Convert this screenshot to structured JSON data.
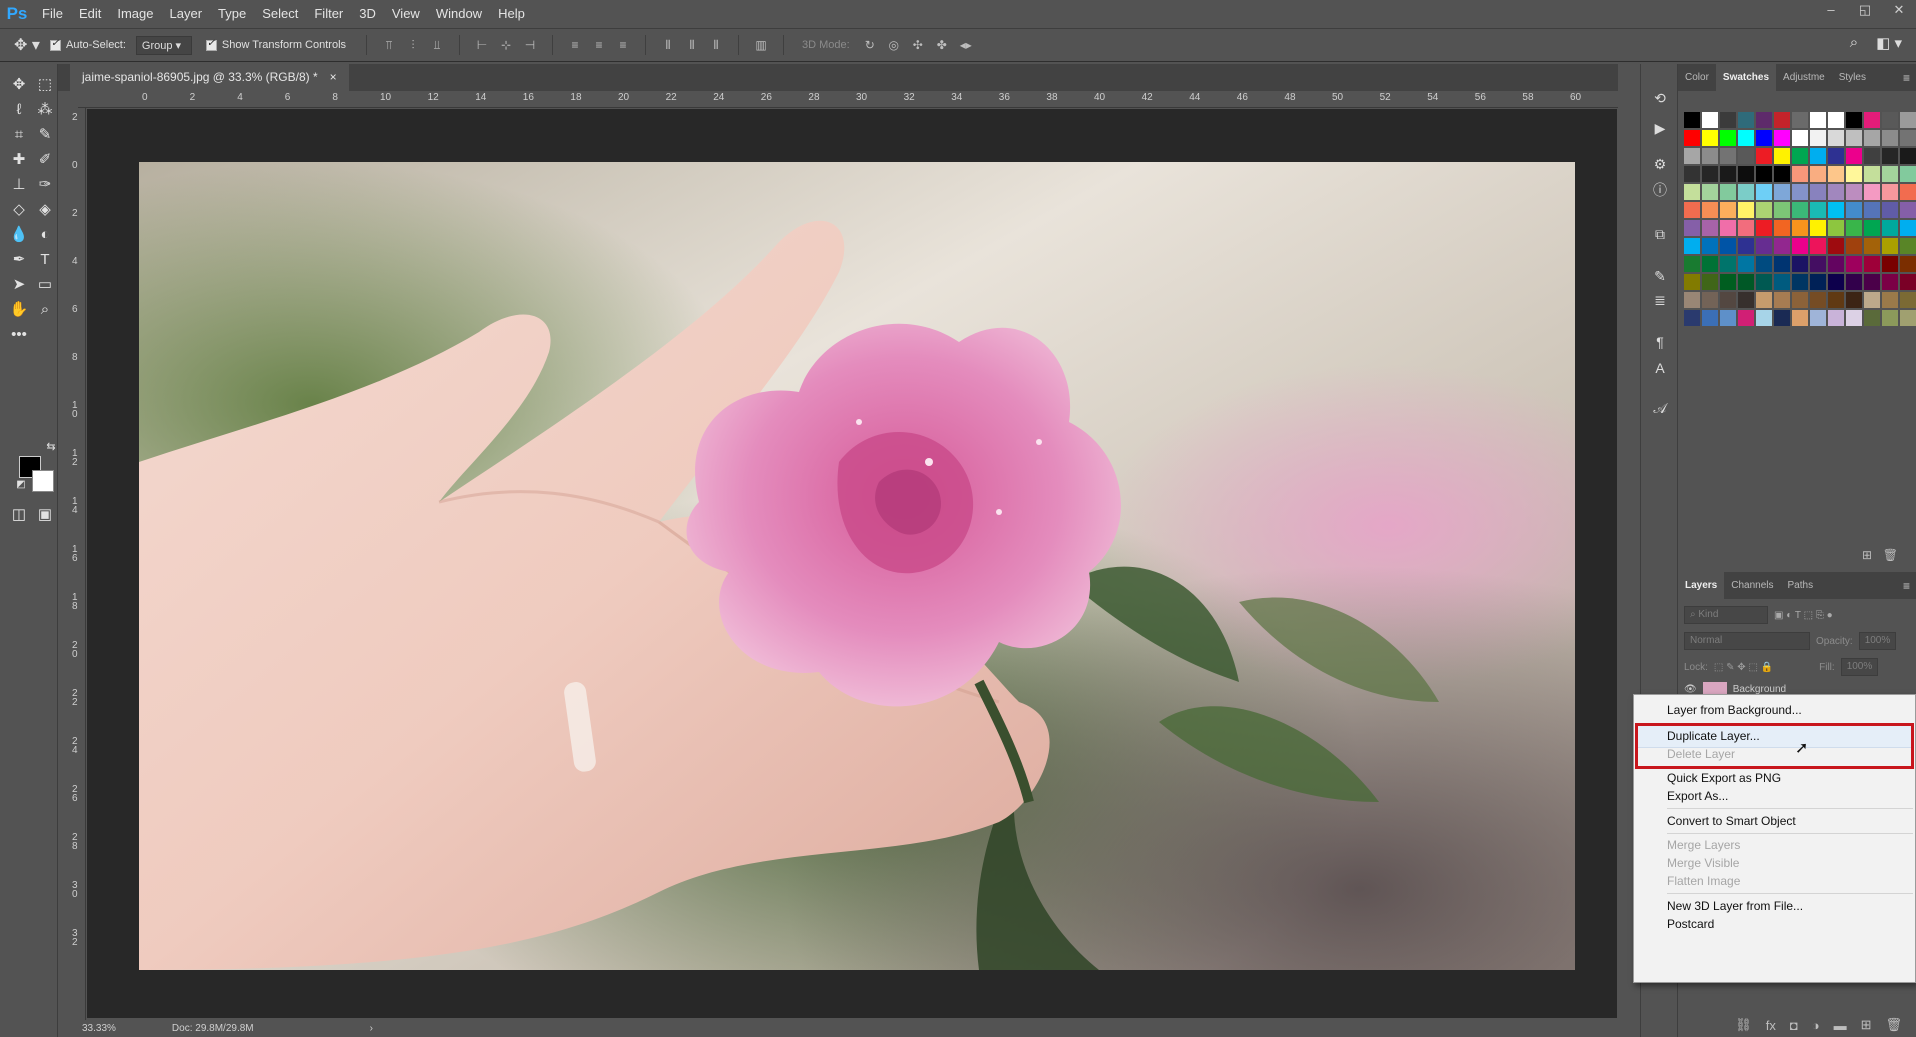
{
  "app": {
    "logo": "Ps",
    "accent": "#31a8ff"
  },
  "menubar": {
    "items": [
      "File",
      "Edit",
      "Image",
      "Layer",
      "Type",
      "Select",
      "Filter",
      "3D",
      "View",
      "Window",
      "Help"
    ],
    "window_controls": [
      "–",
      "◱",
      "✕"
    ]
  },
  "options": {
    "auto_select_label": "Auto-Select:",
    "auto_select_value": "Group",
    "transform_label": "Show Transform Controls",
    "mode_3d_label": "3D Mode:"
  },
  "document": {
    "tab_title": "jaime-spaniol-86905.jpg @ 33.3% (RGB/8) *",
    "tab_close": "×"
  },
  "ruler": {
    "top_ticks": [
      "0",
      "2",
      "4",
      "6",
      "8",
      "10",
      "12",
      "14",
      "16",
      "18",
      "20",
      "22",
      "24",
      "26",
      "28",
      "30",
      "32",
      "34",
      "36",
      "38",
      "40",
      "42",
      "44",
      "46",
      "48",
      "50",
      "52",
      "54",
      "56",
      "58",
      "60"
    ],
    "left_ticks": [
      "2",
      "0",
      "2",
      "4",
      "6",
      "8",
      "1 0",
      "1 2",
      "1 4",
      "1 6",
      "1 8",
      "2 0",
      "2 2",
      "2 4",
      "2 6",
      "2 8",
      "3 0",
      "3 2"
    ]
  },
  "status": {
    "zoom": "33.33%",
    "doc_size": "Doc: 29.8M/29.8M",
    "arrow": "›"
  },
  "swatches_panel": {
    "tabs": [
      "Color",
      "Swatches",
      "Adjustme",
      "Styles"
    ],
    "active_tab": "Swatches",
    "colors": [
      "#000000",
      "#ffffff",
      "#3b3b3b",
      "#2f6b7a",
      "#5e2a6b",
      "#c4232a",
      "#6a6a6a",
      "#ffffff",
      "#ffffff",
      "#000000",
      "#e31c79",
      "#595959",
      "#9b9b9b",
      "#ffffff",
      "#ff0000",
      "#ffff00",
      "#00ff00",
      "#00ffff",
      "#0000ff",
      "#ff00ff",
      "#ffffff",
      "#f2f2f2",
      "#d9d9d9",
      "#bfbfbf",
      "#a6a6a6",
      "#8c8c8c",
      "#737373",
      "#cfcfcf",
      "#a6a6a6",
      "#8c8c8c",
      "#737373",
      "#595959",
      "#ed1c24",
      "#fff200",
      "#00a651",
      "#00aeef",
      "#2e3192",
      "#ec008c",
      "#404040",
      "#262626",
      "#1a1a1a",
      "#c7c7c7",
      "#333333",
      "#262626",
      "#1a1a1a",
      "#0d0d0d",
      "#000000",
      "#000000",
      "#f7977a",
      "#f9ad81",
      "#fdc68a",
      "#fff79a",
      "#c4df9b",
      "#a3d39c",
      "#82ca9d",
      "#7bcdc8",
      "#c4df9b",
      "#a3d39c",
      "#82ca9d",
      "#7bcdc8",
      "#6ecff6",
      "#7ea7d8",
      "#8493ca",
      "#8882be",
      "#a187be",
      "#bc8dbf",
      "#f49ac2",
      "#f6989d",
      "#f26c4f",
      "#f68e55",
      "#f26c4f",
      "#f68e55",
      "#fbaf5c",
      "#fff467",
      "#acd372",
      "#7cc576",
      "#3bb878",
      "#1abbb4",
      "#00bff3",
      "#438ccb",
      "#5574b9",
      "#605ca8",
      "#855fa8",
      "#a763a8",
      "#855fa8",
      "#a763a8",
      "#f06ea9",
      "#f26d7d",
      "#ed1c24",
      "#f26522",
      "#f7941d",
      "#fff200",
      "#8dc63f",
      "#39b54a",
      "#00a651",
      "#00a99d",
      "#00aeef",
      "#0072bc",
      "#00aeef",
      "#0072bc",
      "#0054a6",
      "#2e3192",
      "#662d91",
      "#92278f",
      "#ec008c",
      "#ed145b",
      "#9e0b0f",
      "#a0410d",
      "#a36209",
      "#aba000",
      "#598527",
      "#1a7b30",
      "#197b30",
      "#007236",
      "#00746b",
      "#0076a3",
      "#004b80",
      "#003471",
      "#1b1464",
      "#440e62",
      "#630460",
      "#9e005d",
      "#9e0039",
      "#790000",
      "#7b2e00",
      "#7d4900",
      "#827b00",
      "#406618",
      "#005e20",
      "#005826",
      "#005952",
      "#005b7f",
      "#003663",
      "#002157",
      "#0d004c",
      "#32004b",
      "#4b0049",
      "#7b0046",
      "#7a0026",
      "#c7b299",
      "#998675",
      "#736357",
      "#534741",
      "#37302d",
      "#c69c6d",
      "#a67c52",
      "#8c6239",
      "#754c24",
      "#603913",
      "#3c2415",
      "#bda98b",
      "#9a7a4a",
      "#7b6a34",
      "#e7d3b0",
      "#2a3a6e",
      "#3b6fb6",
      "#5e90c9",
      "#d11f75",
      "#a7d4e8",
      "#1a2a54",
      "#dca06a",
      "#9fb4d8",
      "#c9b3d9",
      "#dcd1e5",
      "#5a6a3a",
      "#8c9a5b",
      "#a0a070",
      "#b8b88a"
    ]
  },
  "layers_panel": {
    "tabs": [
      "Layers",
      "Channels",
      "Paths"
    ],
    "active_tab": "Layers",
    "kind_label": "Kind",
    "blend_mode": "Normal",
    "opacity_label": "Opacity:",
    "opacity_value": "100%",
    "lock_label": "Lock:",
    "fill_label": "Fill:",
    "fill_value": "100%",
    "layer_name": "Background"
  },
  "context_menu": {
    "items": [
      {
        "label": "Layer from Background...",
        "enabled": true
      },
      {
        "label": "Duplicate Layer...",
        "enabled": true,
        "highlighted": true
      },
      {
        "label": "Delete Layer",
        "enabled": false
      },
      {
        "label": "Quick Export as PNG",
        "enabled": true
      },
      {
        "label": "Export As...",
        "enabled": true
      },
      {
        "label": "Convert to Smart Object",
        "enabled": true
      },
      {
        "label": "Merge Layers",
        "enabled": false
      },
      {
        "label": "Merge Visible",
        "enabled": false
      },
      {
        "label": "Flatten Image",
        "enabled": false
      },
      {
        "label": "New 3D Layer from File...",
        "enabled": true
      },
      {
        "label": "Postcard",
        "enabled": true
      }
    ],
    "annotation_color": "#c8161d"
  }
}
